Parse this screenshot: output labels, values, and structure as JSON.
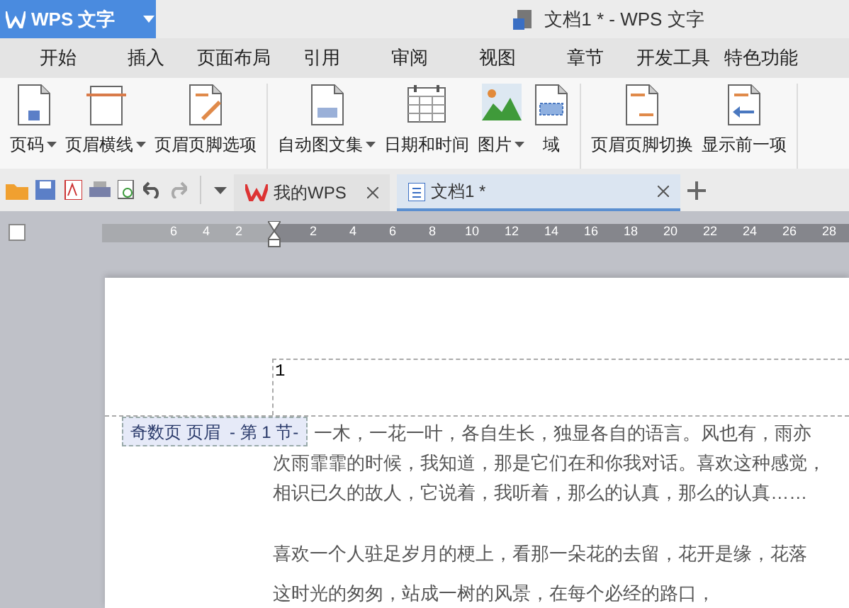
{
  "app_menu": {
    "label": "WPS 文字"
  },
  "window": {
    "title": "文档1 * - WPS 文字"
  },
  "ribbon_tabs": [
    "开始",
    "插入",
    "页面布局",
    "引用",
    "审阅",
    "视图",
    "章节",
    "开发工具",
    "特色功能"
  ],
  "ribbon_groups": [
    [
      {
        "label": "页码",
        "kind": "pagenum",
        "dropdown": true
      },
      {
        "label": "页眉横线",
        "kind": "hline",
        "dropdown": true
      },
      {
        "label": "页眉页脚选项",
        "kind": "options",
        "dropdown": false
      }
    ],
    [
      {
        "label": "自动图文集",
        "kind": "autotext",
        "dropdown": true
      },
      {
        "label": "日期和时间",
        "kind": "calendar",
        "dropdown": false
      },
      {
        "label": "图片",
        "kind": "picture",
        "dropdown": true
      },
      {
        "label": "域",
        "kind": "field",
        "dropdown": false
      }
    ],
    [
      {
        "label": "页眉页脚切换",
        "kind": "switch",
        "dropdown": false
      },
      {
        "label": "显示前一项",
        "kind": "previous",
        "dropdown": false
      }
    ]
  ],
  "doc_tabs": [
    {
      "label": "我的WPS",
      "selected": false
    },
    {
      "label": "文档1 *",
      "selected": true
    }
  ],
  "ruler": {
    "left_ticks": [
      "6",
      "4",
      "2"
    ],
    "right_ticks": [
      "2",
      "4",
      "6",
      "8",
      "10",
      "12",
      "14",
      "16",
      "18",
      "20",
      "22",
      "24",
      "26",
      "28"
    ]
  },
  "page": {
    "header_text": "1",
    "header_label": "奇数页 页眉  - 第 1 节-",
    "paragraphs": [
      [
        "一木，一花一叶，各自生长，独显各自的语言。风也有，雨亦",
        "次雨霏霏的时候，我知道，那是它们在和你我对话。喜欢这种感觉，",
        "相识已久的故人，它说着，我听着，那么的认真，那么的认真……"
      ],
      [
        "喜欢一个人驻足岁月的梗上，看那一朵花的去留，花开是缘，花落"
      ],
      [
        "这时光的匆匆，站成一树的风景，在每个必经的路口，"
      ]
    ]
  }
}
